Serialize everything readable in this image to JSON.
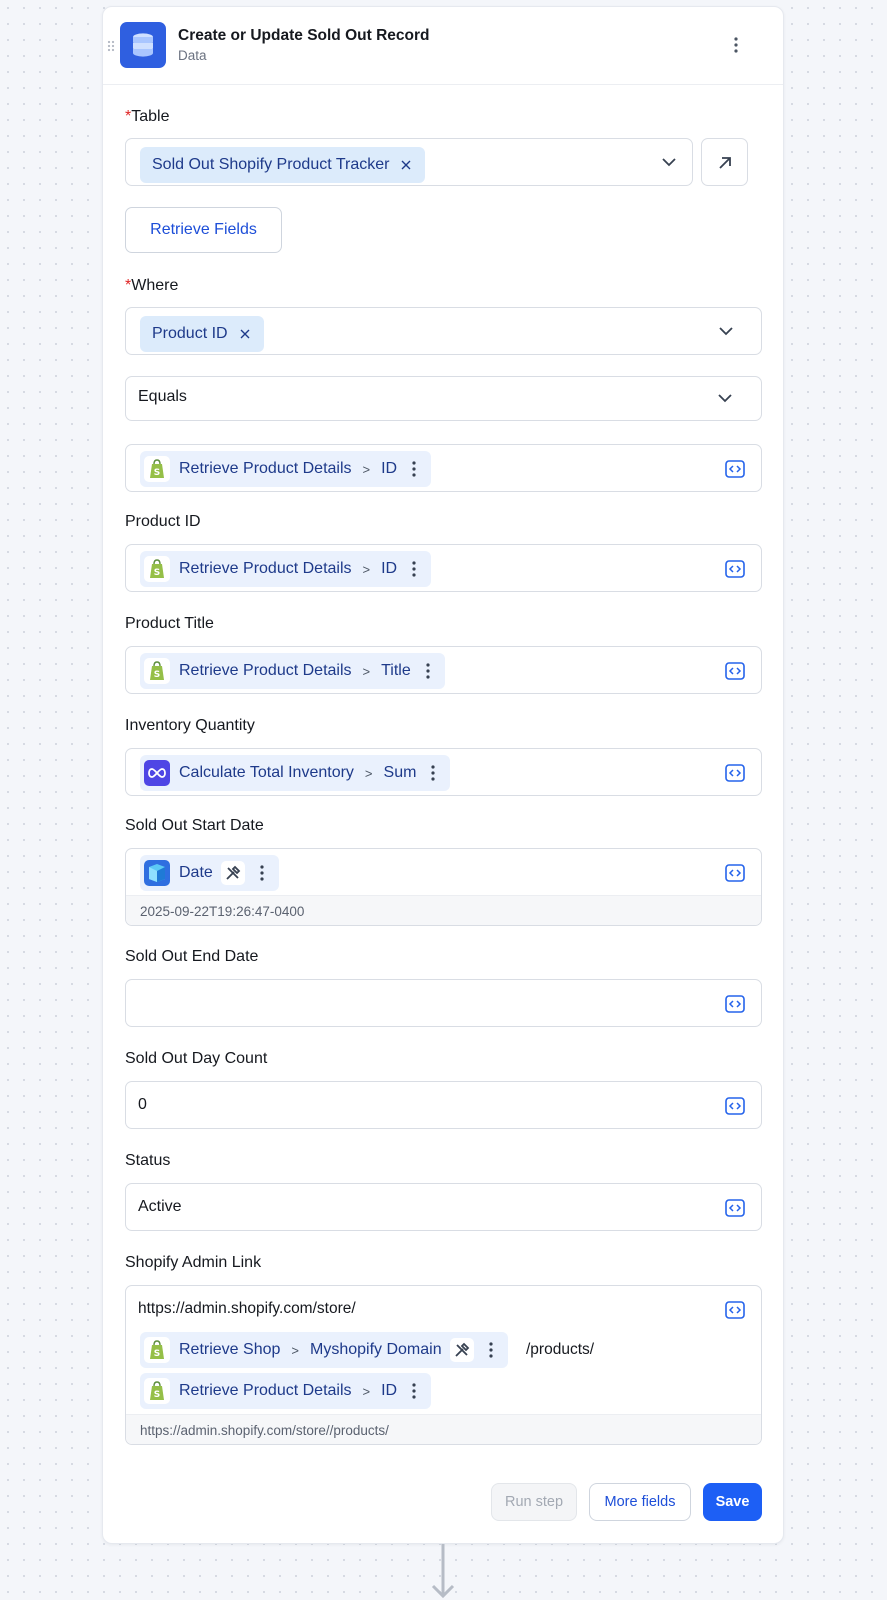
{
  "header": {
    "title": "Create or Update Sold Out Record",
    "subtitle": "Data"
  },
  "table": {
    "label": "Table",
    "selected": "Sold Out Shopify Product Tracker"
  },
  "retrieve_fields_label": "Retrieve Fields",
  "where": {
    "label": "Where",
    "field": "Product ID",
    "operator": "Equals",
    "value": {
      "step": "Retrieve Product Details",
      "field": "ID"
    }
  },
  "fields": {
    "product_id": {
      "label": "Product ID",
      "step": "Retrieve Product Details",
      "field": "ID"
    },
    "product_title": {
      "label": "Product Title",
      "step": "Retrieve Product Details",
      "field": "Title"
    },
    "inventory_quantity": {
      "label": "Inventory Quantity",
      "step": "Calculate Total Inventory",
      "field": "Sum"
    },
    "sold_out_start_date": {
      "label": "Sold Out Start Date",
      "token": "Date",
      "preview": "2025-09-22T19:26:47-0400"
    },
    "sold_out_end_date": {
      "label": "Sold Out End Date",
      "value": ""
    },
    "sold_out_day_count": {
      "label": "Sold Out Day Count",
      "value": "0"
    },
    "status": {
      "label": "Status",
      "value": "Active"
    },
    "shopify_admin_link": {
      "label": "Shopify Admin Link",
      "prefix": "https://admin.shopify.com/store/",
      "token1_step": "Retrieve Shop",
      "token1_field": "Myshopify Domain",
      "mid": "/products/",
      "token2_step": "Retrieve Product Details",
      "token2_field": "ID",
      "preview": "https://admin.shopify.com/store//products/"
    }
  },
  "footer": {
    "run_step": "Run step",
    "more_fields": "More fields",
    "save": "Save"
  },
  "colors": {
    "accent": "#1d5ff5",
    "chip_bg": "#eaf1fd",
    "required": "#e02424",
    "shopify_green": "#95bf47"
  },
  "icons": [
    "database-icon",
    "kebab-menu-icon",
    "chevron-down-icon",
    "external-link-icon",
    "close-icon",
    "shopify-icon",
    "loop-icon",
    "date-tool-icon",
    "tools-icon",
    "code-icon",
    "arrow-down-icon"
  ]
}
